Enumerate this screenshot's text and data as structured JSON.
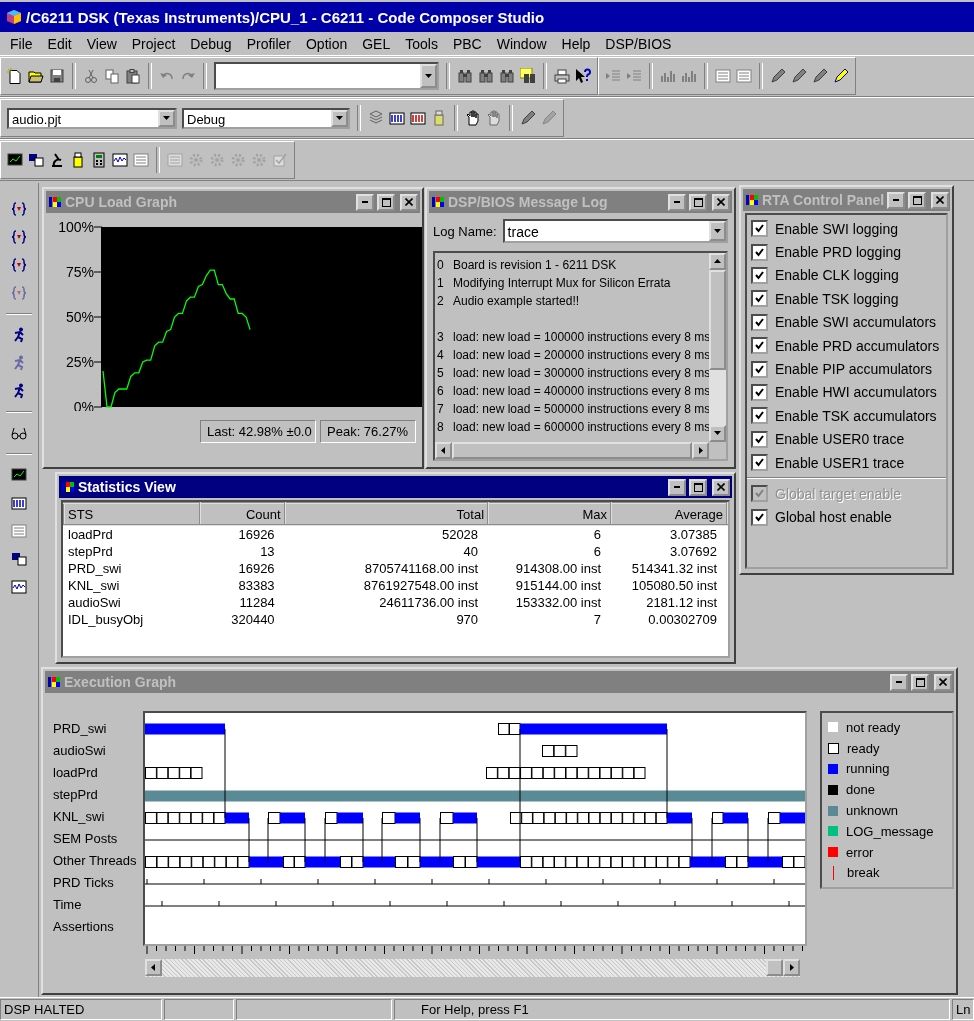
{
  "window": {
    "title": "/C6211 DSK (Texas Instruments)/CPU_1 - C6211 - Code Composer Studio"
  },
  "menu": [
    "File",
    "Edit",
    "View",
    "Project",
    "Debug",
    "Profiler",
    "Option",
    "GEL",
    "Tools",
    "PBC",
    "Window",
    "Help",
    "DSP/BIOS"
  ],
  "toolbar": {
    "project": "audio.pjt",
    "configuration": "Debug"
  },
  "cpu_load_graph": {
    "title": "CPU Load Graph",
    "active": false,
    "chart_data": {
      "type": "line",
      "ylim": [
        0,
        100
      ],
      "yticks": [
        {
          "value": 0,
          "label": "0%"
        },
        {
          "value": 25,
          "label": "25%"
        },
        {
          "value": 50,
          "label": "50%"
        },
        {
          "value": 75,
          "label": "75%"
        },
        {
          "value": 100,
          "label": "100%"
        }
      ],
      "categories": [
        null,
        null,
        null,
        null,
        null,
        null,
        null,
        null,
        null,
        null,
        null,
        null,
        null,
        null,
        null,
        null,
        null,
        null,
        null,
        null,
        null,
        null,
        null,
        null,
        null,
        null,
        null,
        null,
        null,
        null,
        null,
        null,
        null,
        null,
        null,
        null,
        null,
        null
      ],
      "series": [
        {
          "color": "#00ff00",
          "values": [
            20,
            0,
            0,
            8,
            10,
            10,
            10,
            17,
            19,
            19,
            25,
            26,
            26,
            34,
            36,
            36,
            42,
            43,
            50,
            52,
            52,
            59,
            61,
            61,
            67,
            68,
            73,
            76,
            76,
            68,
            68,
            63,
            60,
            60,
            52,
            52,
            50,
            43
          ]
        }
      ]
    },
    "last": "Last: 42.98%  ±0.0",
    "peak": "Peak: 76.27%"
  },
  "message_log": {
    "title": "DSP/BIOS Message Log",
    "active": false,
    "log_name_label": "Log Name:",
    "log_name": "trace",
    "entries": [
      {
        "index": "0",
        "text": "Board is revision 1 - 6211 DSK"
      },
      {
        "index": "1",
        "text": "Modifying Interrupt Mux for Silicon Errata"
      },
      {
        "index": "2",
        "text": "Audio example started!!"
      },
      {
        "index": "3",
        "text": "load: new load = 100000 instructions every 8 ms",
        "gap_before": true
      },
      {
        "index": "4",
        "text": "load: new load = 200000 instructions every 8 ms"
      },
      {
        "index": "5",
        "text": "load: new load = 300000 instructions every 8 ms"
      },
      {
        "index": "6",
        "text": "load: new load = 400000 instructions every 8 ms"
      },
      {
        "index": "7",
        "text": "load: new load = 500000 instructions every 8 ms"
      },
      {
        "index": "8",
        "text": "load: new load = 600000 instructions every 8 ms"
      }
    ]
  },
  "rta_control_panel": {
    "title": "RTA Control Panel",
    "active": false,
    "options": [
      {
        "label": "Enable SWI logging",
        "checked": true,
        "disabled": false
      },
      {
        "label": "Enable PRD logging",
        "checked": true,
        "disabled": false
      },
      {
        "label": "Enable CLK logging",
        "checked": true,
        "disabled": false
      },
      {
        "label": "Enable TSK logging",
        "checked": true,
        "disabled": false
      },
      {
        "label": "Enable SWI accumulators",
        "checked": true,
        "disabled": false
      },
      {
        "label": "Enable PRD accumulators",
        "checked": true,
        "disabled": false
      },
      {
        "label": "Enable PIP accumulators",
        "checked": true,
        "disabled": false
      },
      {
        "label": "Enable HWI accumulators",
        "checked": true,
        "disabled": false
      },
      {
        "label": "Enable TSK accumulators",
        "checked": true,
        "disabled": false
      },
      {
        "label": "Enable USER0 trace",
        "checked": true,
        "disabled": false
      },
      {
        "label": "Enable USER1 trace",
        "checked": true,
        "disabled": false
      },
      {
        "label": "Global target enable",
        "checked": true,
        "disabled": true,
        "separator_before": true
      },
      {
        "label": "Global host enable",
        "checked": true,
        "disabled": false
      }
    ]
  },
  "statistics_view": {
    "title": "Statistics View",
    "active": true,
    "columns": [
      "STS",
      "Count",
      "Total",
      "Max",
      "Average"
    ],
    "rows": [
      [
        "loadPrd",
        "16926",
        "52028",
        "6",
        "3.07385"
      ],
      [
        "stepPrd",
        "13",
        "40",
        "6",
        "3.07692"
      ],
      [
        "PRD_swi",
        "16926",
        "8705741168.00 inst",
        "914308.00 inst",
        "514341.32 inst"
      ],
      [
        "KNL_swi",
        "83383",
        "8761927548.00 inst",
        "915144.00 inst",
        "105080.50 inst"
      ],
      [
        "audioSwi",
        "11284",
        "24611736.00 inst",
        "153332.00 inst",
        "2181.12 inst"
      ],
      [
        "IDL_busyObj",
        "320440",
        "970",
        "7",
        "0.00302709"
      ]
    ]
  },
  "execution_graph": {
    "title": "Execution Graph",
    "active": false,
    "rows": [
      "PRD_swi",
      "audioSwi",
      "loadPrd",
      "stepPrd",
      "KNL_swi",
      "SEM Posts",
      "Other Threads",
      "PRD Ticks",
      "Time",
      "Assertions"
    ],
    "legend": [
      {
        "label": "not ready",
        "kind": "fill",
        "color": "#ffffff"
      },
      {
        "label": "ready",
        "kind": "outline",
        "color": "#ffffff"
      },
      {
        "label": "running",
        "kind": "fill",
        "color": "#0000ff"
      },
      {
        "label": "done",
        "kind": "fill",
        "color": "#000000"
      },
      {
        "label": "unknown",
        "kind": "fill",
        "color": "#5a8a96"
      },
      {
        "label": "LOG_message",
        "kind": "fill",
        "color": "#00c080"
      },
      {
        "label": "error",
        "kind": "fill",
        "color": "#ff0000"
      },
      {
        "label": "break",
        "kind": "line",
        "color": "#ff0000"
      }
    ]
  },
  "status_bar": {
    "state": "DSP HALTED",
    "help": "For Help, press F1",
    "position": "Ln"
  }
}
